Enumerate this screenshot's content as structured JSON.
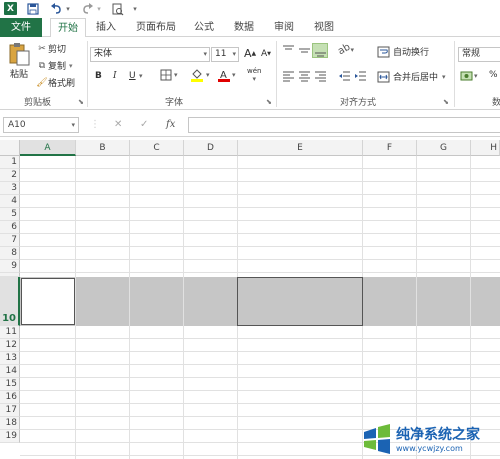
{
  "quick_access": {
    "app_icon": "X",
    "save_icon": "save-icon",
    "undo_icon": "undo-icon",
    "redo_icon": "redo-icon",
    "preview_icon": "print-preview-icon"
  },
  "tabs": [
    {
      "label": "文件"
    },
    {
      "label": "开始"
    },
    {
      "label": "插入"
    },
    {
      "label": "页面布局"
    },
    {
      "label": "公式"
    },
    {
      "label": "数据"
    },
    {
      "label": "审阅"
    },
    {
      "label": "视图"
    }
  ],
  "ribbon": {
    "clipboard": {
      "paste": "粘贴",
      "cut": "剪切",
      "copy": "复制",
      "format_painter": "格式刷",
      "group_label": "剪贴板"
    },
    "font": {
      "font_name": "宋体",
      "font_size": "11",
      "bold": "B",
      "italic": "I",
      "underline": "U",
      "grow": "A",
      "shrink": "A",
      "phonetic": "wén",
      "group_label": "字体"
    },
    "alignment": {
      "wrap_text": "自动换行",
      "merge_center": "合并后居中",
      "group_label": "对齐方式"
    },
    "number": {
      "format": "常规",
      "percent": "%",
      "group_label_partial": "数"
    }
  },
  "formula_bar": {
    "name_box": "A10",
    "cancel": "✕",
    "enter": "✓",
    "fx": "fx",
    "formula": ""
  },
  "columns": [
    "A",
    "B",
    "C",
    "D",
    "E",
    "F",
    "G",
    "H"
  ],
  "rows": [
    "1",
    "2",
    "3",
    "4",
    "5",
    "6",
    "7",
    "8",
    "9",
    "10",
    "11",
    "12",
    "13",
    "14",
    "15",
    "16",
    "17",
    "18",
    "19"
  ],
  "selection": {
    "active_cell": "A10",
    "selected_row": "10"
  },
  "watermark": {
    "title": "纯净系统之家",
    "url": "www.ycwjzy.com"
  },
  "colors": {
    "brand": "#217346",
    "selection": "#c6c6c6",
    "watermark": "#1b63b3"
  }
}
